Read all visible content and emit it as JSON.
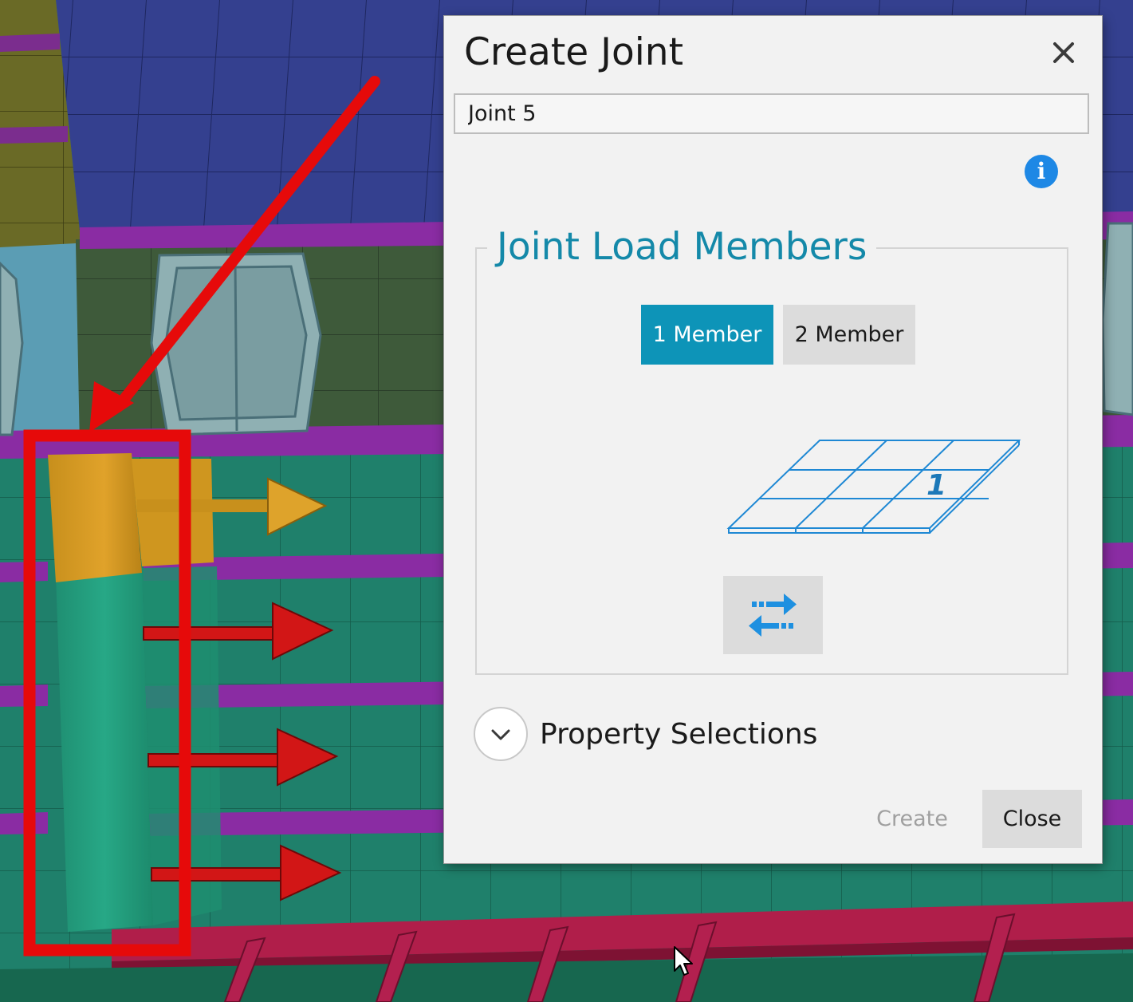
{
  "dialog": {
    "title": "Create Joint",
    "close_icon": "close-icon",
    "name_value": "Joint 5",
    "info_icon": "info-icon",
    "info_glyph": "i",
    "group": {
      "title": "Joint Load Members",
      "options": [
        "1 Member",
        "2 Member"
      ],
      "selected": "1 Member",
      "diagram_icon": "plate-member-diagram",
      "diagram_label": "1",
      "swap_icon": "swap-direction-icon"
    },
    "property_selections": {
      "label": "Property Selections",
      "expanded": false,
      "expander_icon": "chevron-down-icon"
    },
    "buttons": {
      "create": "Create",
      "create_enabled": false,
      "close": "Close"
    }
  },
  "colors": {
    "accent": "#0d94b8",
    "heading": "#1489a9",
    "info": "#1e88e5",
    "swap_arrows": "#1e90e0",
    "highlight_box": "#e60a0a",
    "annotation_arrow": "#e60a0a"
  },
  "viewport": {
    "annotation": "red-highlight-box-with-arrow",
    "cursor_icon": "mouse-pointer-icon"
  }
}
